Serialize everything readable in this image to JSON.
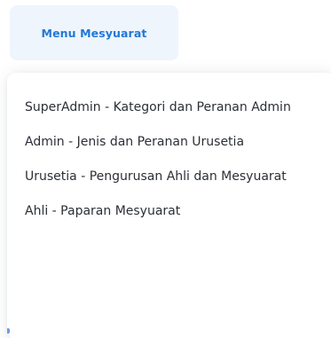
{
  "menu": {
    "tab_label": "Menu Mesyuarat",
    "items": [
      {
        "label": "SuperAdmin - Kategori dan Peranan Admin"
      },
      {
        "label": "Admin - Jenis dan Peranan Urusetia"
      },
      {
        "label": "Urusetia - Pengurusan Ahli dan Mesyuarat"
      },
      {
        "label": "Ahli - Paparan Mesyuarat"
      }
    ]
  },
  "colors": {
    "tab_background": "#eef5fd",
    "tab_text": "#2178d8",
    "item_text": "#2b2f36",
    "dropdown_background": "#ffffff"
  }
}
